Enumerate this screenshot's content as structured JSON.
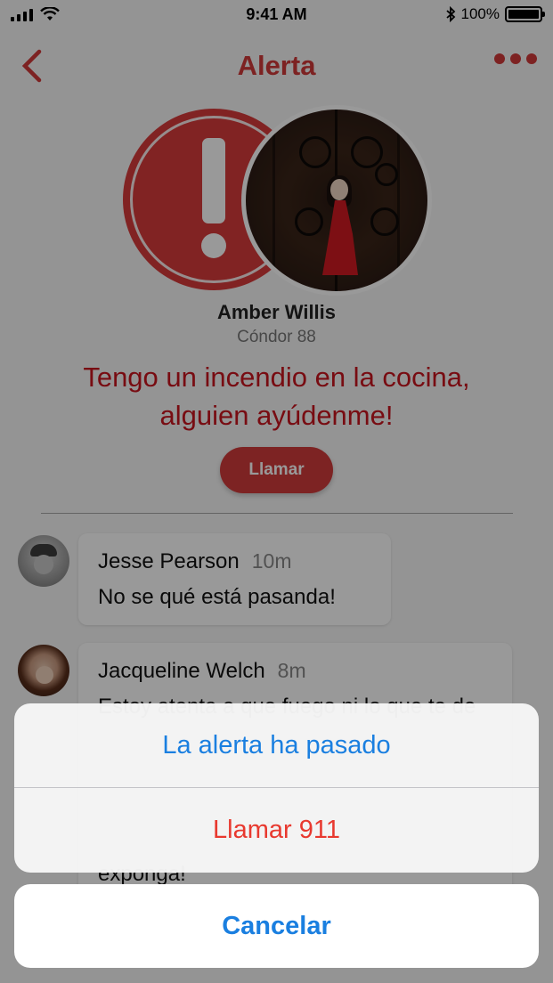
{
  "status_bar": {
    "time": "9:41 AM",
    "battery": "100%",
    "battery_level": 1.0,
    "icons": [
      "signal-icon",
      "wifi-icon",
      "bluetooth-icon",
      "battery-icon"
    ]
  },
  "navbar": {
    "title": "Alerta",
    "back_icon": "chevron-left-icon",
    "more_icon": "more-icon"
  },
  "alert": {
    "user_name": "Amber Willis",
    "user_handle": "Cóndor 88",
    "message_line1": "Tengo un incendio en la cocina,",
    "message_line2": "alguien ayúdenme!",
    "call_label": "Llamar"
  },
  "comments": [
    {
      "name": "Jesse Pearson",
      "time": "10m",
      "text": "No se qué está pasanda!"
    },
    {
      "name": "Jacqueline Welch",
      "time": "8m",
      "text": "Estoy atenta a que fuego ni lo que te de",
      "text_tail": "exponga!"
    }
  ],
  "action_sheet": {
    "option1": "La alerta ha pasado",
    "option2": "Llamar 911",
    "cancel": "Cancelar"
  },
  "colors": {
    "accent_red": "#d03a3a",
    "alert_text": "#c8141e",
    "ios_blue": "#1a7fe0",
    "ios_red": "#e8392f"
  }
}
